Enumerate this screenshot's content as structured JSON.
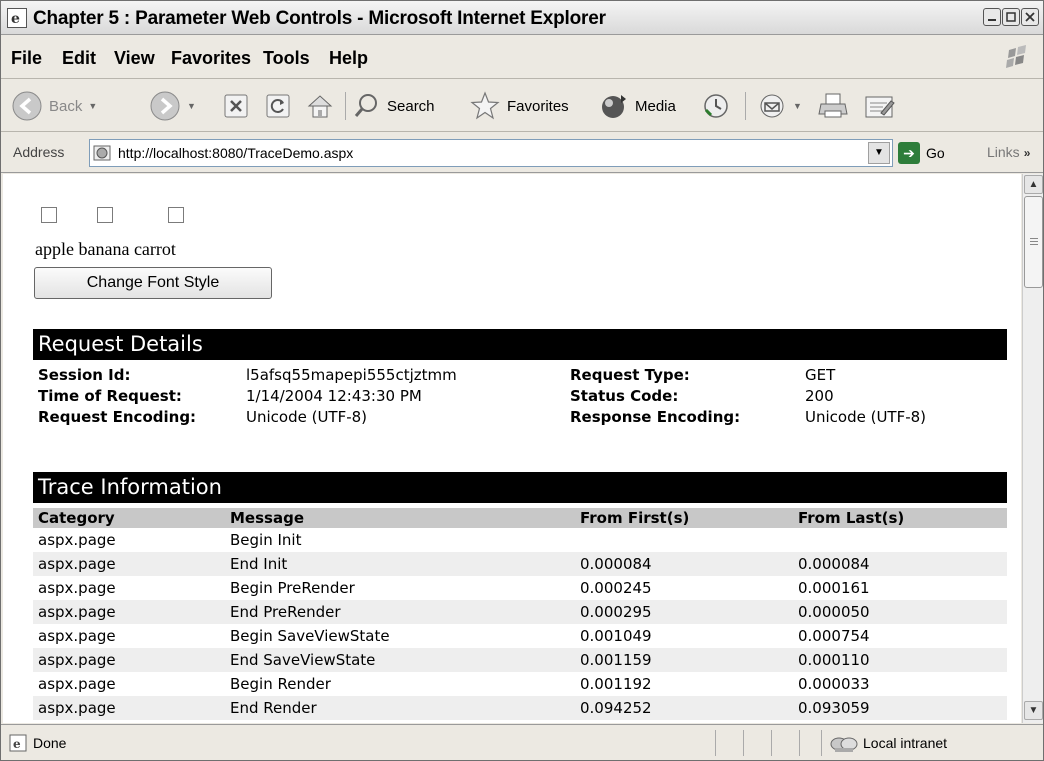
{
  "window": {
    "title": "Chapter 5 : Parameter Web Controls - Microsoft Internet Explorer"
  },
  "menu": {
    "items": [
      "File",
      "Edit",
      "View",
      "Favorites",
      "Tools",
      "Help"
    ]
  },
  "toolbar": {
    "back_label": "Back",
    "search_label": "Search",
    "favorites_label": "Favorites",
    "media_label": "Media"
  },
  "address": {
    "label": "Address",
    "url": "http://localhost:8080/TraceDemo.aspx",
    "go_label": "Go",
    "links_label": "Links"
  },
  "page": {
    "checkbox_count": 3,
    "fruit_text": "apple banana carrot",
    "button_label": "Change Font Style"
  },
  "request_details": {
    "heading": "Request Details",
    "session_id_label": "Session Id:",
    "session_id": "l5afsq55mapepi555ctjztmm",
    "time_label": "Time of Request:",
    "time": "1/14/2004 12:43:30 PM",
    "req_encoding_label": "Request Encoding:",
    "req_encoding": "Unicode (UTF-8)",
    "request_type_label": "Request Type:",
    "request_type": "GET",
    "status_code_label": "Status Code:",
    "status_code": "200",
    "resp_encoding_label": "Response Encoding:",
    "resp_encoding": "Unicode (UTF-8)"
  },
  "trace": {
    "heading": "Trace Information",
    "columns": [
      "Category",
      "Message",
      "From First(s)",
      "From Last(s)"
    ],
    "rows": [
      [
        "aspx.page",
        "Begin Init",
        "",
        ""
      ],
      [
        "aspx.page",
        "End Init",
        "0.000084",
        "0.000084"
      ],
      [
        "aspx.page",
        "Begin PreRender",
        "0.000245",
        "0.000161"
      ],
      [
        "aspx.page",
        "End PreRender",
        "0.000295",
        "0.000050"
      ],
      [
        "aspx.page",
        "Begin SaveViewState",
        "0.001049",
        "0.000754"
      ],
      [
        "aspx.page",
        "End SaveViewState",
        "0.001159",
        "0.000110"
      ],
      [
        "aspx.page",
        "Begin Render",
        "0.001192",
        "0.000033"
      ],
      [
        "aspx.page",
        "End Render",
        "0.094252",
        "0.093059"
      ]
    ]
  },
  "status": {
    "text": "Done",
    "zone": "Local intranet"
  }
}
